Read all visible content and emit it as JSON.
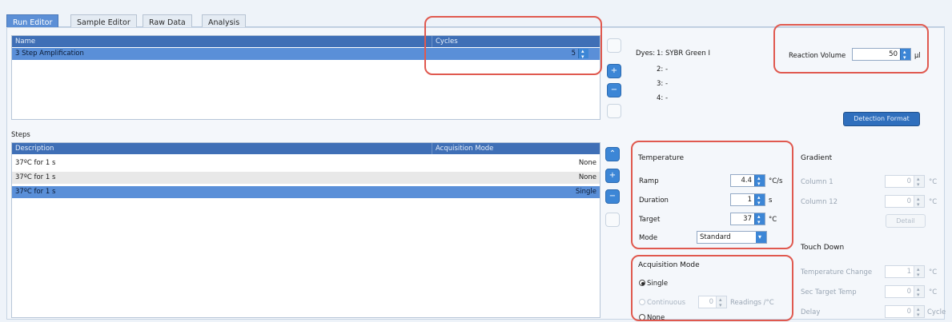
{
  "tabs": [
    "Run Editor",
    "Sample Editor",
    "Raw Data",
    "Analysis"
  ],
  "program_table": {
    "headers": {
      "name": "Name",
      "cycles": "Cycles"
    },
    "rows": [
      {
        "name": "3 Step Amplification",
        "cycles": "5"
      }
    ]
  },
  "dyes": {
    "label": "Dyes:",
    "items": [
      "1:  SYBR Green I",
      "2:  -",
      "3:  -",
      "4:  -"
    ]
  },
  "reaction_volume": {
    "label": "Reaction Volume",
    "value": "50",
    "unit": "µl"
  },
  "detection_format_label": "Detection Format",
  "steps": {
    "title": "Steps",
    "headers": {
      "description": "Description",
      "acquisition": "Acquisition Mode"
    },
    "rows": [
      {
        "description": "37ºC for 1 s",
        "acquisition": "None"
      },
      {
        "description": "37ºC for 1 s",
        "acquisition": "None"
      },
      {
        "description": "37ºC for 1 s",
        "acquisition": "Single"
      }
    ]
  },
  "temperature": {
    "title": "Temperature",
    "ramp": {
      "label": "Ramp",
      "value": "4.4",
      "unit": "°C/s"
    },
    "duration": {
      "label": "Duration",
      "value": "1",
      "unit": "s"
    },
    "target": {
      "label": "Target",
      "value": "37",
      "unit": "°C"
    },
    "mode": {
      "label": "Mode",
      "value": "Standard"
    }
  },
  "acquisition_mode": {
    "title": "Acquisition Mode",
    "single": "Single",
    "continuous": "Continuous",
    "continuous_value": "0",
    "continuous_unit": "Readings /°C",
    "none": "None"
  },
  "gradient": {
    "title": "Gradient",
    "column1": {
      "label": "Column 1",
      "value": "0",
      "unit": "°C"
    },
    "column12": {
      "label": "Column 12",
      "value": "0",
      "unit": "°C"
    },
    "detail_label": "Detail"
  },
  "touch_down": {
    "title": "Touch Down",
    "temp_change": {
      "label": "Temperature Change",
      "value": "1",
      "unit": "°C"
    },
    "sec_target": {
      "label": "Sec Target Temp",
      "value": "0",
      "unit": "°C"
    },
    "delay": {
      "label": "Delay",
      "value": "0",
      "unit": "Cycle"
    }
  },
  "colors": {
    "accent": "#3c86d6",
    "header": "#3f6fb6",
    "selection": "#5a8fd8",
    "highlight": "#e0594f"
  }
}
